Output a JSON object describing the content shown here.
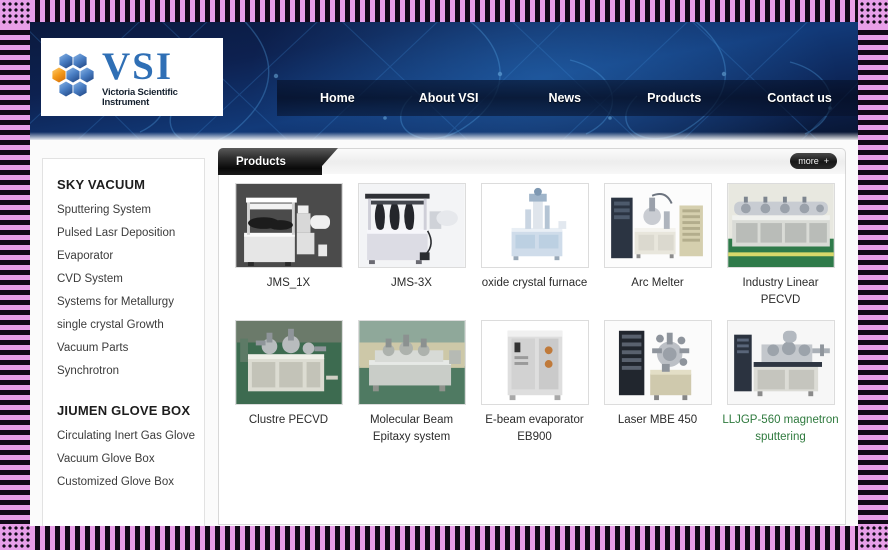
{
  "site": {
    "logo": {
      "brand": "VSI",
      "subtitle": "Victoria Scientific Instrument",
      "icon": "hexagon-cluster-icon"
    },
    "nav": [
      {
        "label": "Home",
        "name": "nav-home"
      },
      {
        "label": "About VSI",
        "name": "nav-about-vsi"
      },
      {
        "label": "News",
        "name": "nav-news"
      },
      {
        "label": "Products",
        "name": "nav-products"
      },
      {
        "label": "Contact us",
        "name": "nav-contact-us"
      }
    ]
  },
  "sidebar": {
    "group1": {
      "heading": "SKY VACUUM",
      "items": [
        "Sputtering System",
        "Pulsed Lasr Deposition",
        "Evaporator",
        "CVD System",
        "Systems for Metallurgy",
        "single crystal Growth",
        "Vacuum Parts",
        "Synchrotron"
      ]
    },
    "group2": {
      "heading": "JIUMEN GLOVE BOX",
      "items": [
        "Circulating Inert Gas Glove",
        "Vacuum Glove Box",
        "Customized Glove Box"
      ]
    }
  },
  "panel": {
    "tab_label": "Products",
    "more_label": "more",
    "more_plus": "+"
  },
  "products": {
    "row1": [
      {
        "label": "JMS_1X",
        "style": "dark"
      },
      {
        "label": "JMS-3X",
        "style": "glovebox"
      },
      {
        "label": "oxide crystal furnace",
        "style": "furnace"
      },
      {
        "label": "Arc Melter",
        "style": "arcmelter"
      },
      {
        "label": "Industry Linear PECVD",
        "style": "linear"
      }
    ],
    "row2": [
      {
        "label": "Clustre PECVD",
        "style": "cluster"
      },
      {
        "label": "Molecular Beam Epitaxy system",
        "style": "mbe"
      },
      {
        "label": "E-beam evaporator EB900",
        "style": "ebeam"
      },
      {
        "label": "Laser MBE 450",
        "style": "lasermbe"
      },
      {
        "label": "LLJGP-560 magnetron sputtering",
        "style": "magnetron",
        "link": "green"
      }
    ]
  },
  "colors": {
    "banner_dark": "#0b1a3e",
    "banner_blue": "#123a79",
    "frame_pink": "#e89fe8",
    "frame_dark": "#120a18",
    "green_link": "#2f7a3e",
    "logo_blue": "#2f6fb5"
  }
}
